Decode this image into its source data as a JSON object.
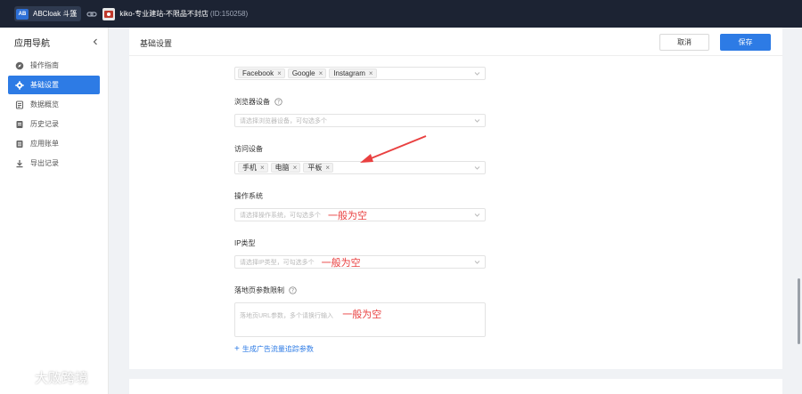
{
  "topbar": {
    "brand_logo": "AB",
    "brand_name": "ABCloak 斗篷",
    "store_name": "kiko-专业建站-不限品不封店",
    "store_id": "(ID:150258)"
  },
  "sidebar": {
    "title": "应用导航",
    "items": [
      {
        "label": "操作指南",
        "icon": "compass-icon"
      },
      {
        "label": "基础设置",
        "icon": "gear-icon",
        "active": true
      },
      {
        "label": "数据概览",
        "icon": "data-icon"
      },
      {
        "label": "历史记录",
        "icon": "history-icon"
      },
      {
        "label": "应用账单",
        "icon": "bill-icon"
      },
      {
        "label": "导出记录",
        "icon": "download-icon"
      }
    ]
  },
  "header": {
    "title": "基础设置",
    "cancel_label": "取消",
    "save_label": "保存"
  },
  "form": {
    "traffic_source": {
      "tags": [
        "Facebook",
        "Google",
        "Instagram"
      ]
    },
    "browser": {
      "label": "浏览器设备",
      "placeholder": "请选择浏览器设备，可勾选多个"
    },
    "device": {
      "label": "访问设备",
      "tags": [
        "手机",
        "电脑",
        "平板"
      ]
    },
    "os": {
      "label": "操作系统",
      "placeholder": "请选择操作系统，可勾选多个",
      "note": "一般为空"
    },
    "ip_type": {
      "label": "IP类型",
      "placeholder": "请选择IP类型，可勾选多个",
      "note": "一般为空"
    },
    "landing_params": {
      "label": "落地页参数限制",
      "placeholder": "落地页URL参数，多个请换行输入",
      "note": "一般为空"
    },
    "generate_link": "生成广告流量追踪参数"
  },
  "watermark": {
    "text": "大败跨境"
  },
  "colors": {
    "accent": "#2d7be5",
    "topbar": "#1c2333",
    "note": "#e94040"
  }
}
